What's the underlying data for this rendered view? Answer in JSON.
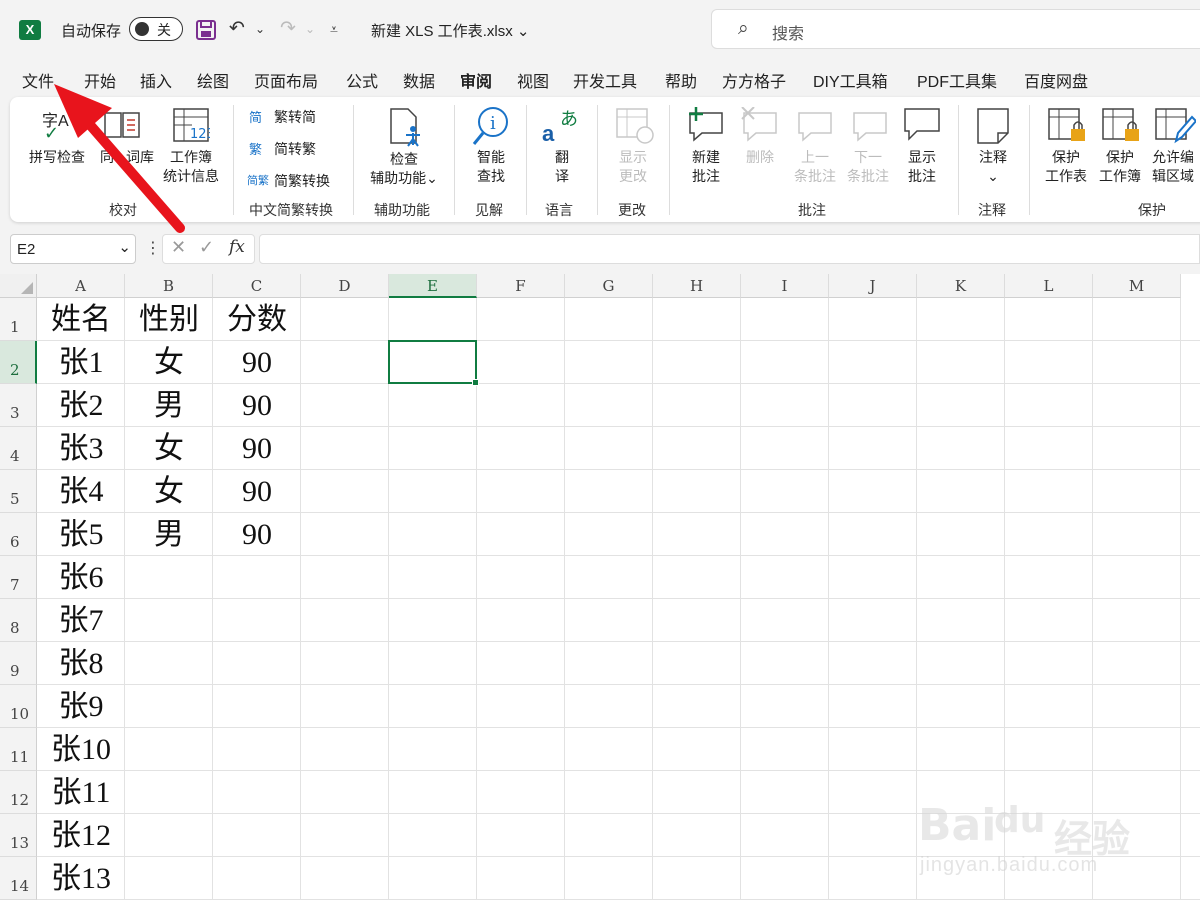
{
  "titlebar": {
    "logo_letter": "X",
    "autosave_label": "自动保存",
    "autosave_state": "关",
    "doc_title": "新建 XLS 工作表.xlsx",
    "doc_title_caret": "⌄",
    "search_placeholder": "搜索",
    "save_icon": "save-icon",
    "undo_icon": "undo-icon",
    "redo_icon": "redo-icon"
  },
  "tabs": [
    "文件",
    "开始",
    "插入",
    "绘图",
    "页面布局",
    "公式",
    "数据",
    "审阅",
    "视图",
    "开发工具",
    "帮助",
    "方方格子",
    "DIY工具箱",
    "PDF工具集",
    "百度网盘"
  ],
  "active_tab": "审阅",
  "ribbon": {
    "proofing": {
      "spelling": "拼写检查",
      "thesaurus_a": "同",
      "thesaurus_b": "词库",
      "workbook_stats_1": "工作簿",
      "workbook_stats_2": "统计信息",
      "spelling_glyph": "字A",
      "stats_glyph": "123",
      "group": "校对"
    },
    "chinese": {
      "to_simplified": "繁转简",
      "to_traditional": "简转繁",
      "convert": "简繁转换",
      "group": "中文简繁转换",
      "glyph_simplified": "简",
      "glyph_traditional": "繁",
      "glyph_convert": "简繁"
    },
    "accessibility": {
      "check_1": "检查",
      "check_2": "辅助功能",
      "check_caret": "⌄",
      "group": "辅助功能"
    },
    "insights": {
      "smart_1": "智能",
      "smart_2": "查找",
      "group": "见解",
      "glyph": "i"
    },
    "language": {
      "translate_1": "翻",
      "translate_2": "译",
      "group": "语言",
      "glyph_a": "a",
      "glyph_jp": "あ"
    },
    "changes": {
      "show_1": "显示",
      "show_2": "更改",
      "group": "更改"
    },
    "comments": {
      "new_1": "新建",
      "new_2": "批注",
      "delete": "删除",
      "prev_1": "上一",
      "prev_2": "条批注",
      "next_1": "下一",
      "next_2": "条批注",
      "show_1": "显示",
      "show_2": "批注",
      "group": "批注"
    },
    "notes": {
      "label": "注释",
      "caret": "⌄",
      "group": "注释"
    },
    "protect": {
      "sheet_1": "保护",
      "sheet_2": "工作表",
      "book_1": "保护",
      "book_2": "工作簿",
      "range_1": "允许编",
      "range_2": "辑区域",
      "group": "保护"
    }
  },
  "formula_bar": {
    "name_box": "E2",
    "name_caret": "⌄",
    "menu_glyph": "⋮",
    "cancel": "✕",
    "confirm": "✓",
    "fx": "fx",
    "value": ""
  },
  "columns": [
    "A",
    "B",
    "C",
    "D",
    "E",
    "F",
    "G",
    "H",
    "I",
    "J",
    "K",
    "L",
    "M"
  ],
  "selected_column": "E",
  "rows": [
    "1",
    "2",
    "3",
    "4",
    "5",
    "6",
    "7",
    "8",
    "9",
    "10",
    "11",
    "12",
    "13",
    "14"
  ],
  "selected_row": "2",
  "cells": [
    [
      "姓名",
      "性别",
      "分数"
    ],
    [
      "张1",
      "女",
      "90"
    ],
    [
      "张2",
      "男",
      "90"
    ],
    [
      "张3",
      "女",
      "90"
    ],
    [
      "张4",
      "女",
      "90"
    ],
    [
      "张5",
      "男",
      "90"
    ],
    [
      "张6",
      "",
      ""
    ],
    [
      "张7",
      "",
      ""
    ],
    [
      "张8",
      "",
      ""
    ],
    [
      "张9",
      "",
      ""
    ],
    [
      "张10",
      "",
      ""
    ],
    [
      "张11",
      "",
      ""
    ],
    [
      "张12",
      "",
      ""
    ],
    [
      "张13",
      "",
      ""
    ]
  ],
  "selected_cell": "E2",
  "watermark": {
    "brand": "Bai",
    "paw": "du",
    "name": "经验",
    "url": "jingyan.baidu.com"
  },
  "colors": {
    "accent": "#107c41",
    "arrow": "#e8141c"
  }
}
